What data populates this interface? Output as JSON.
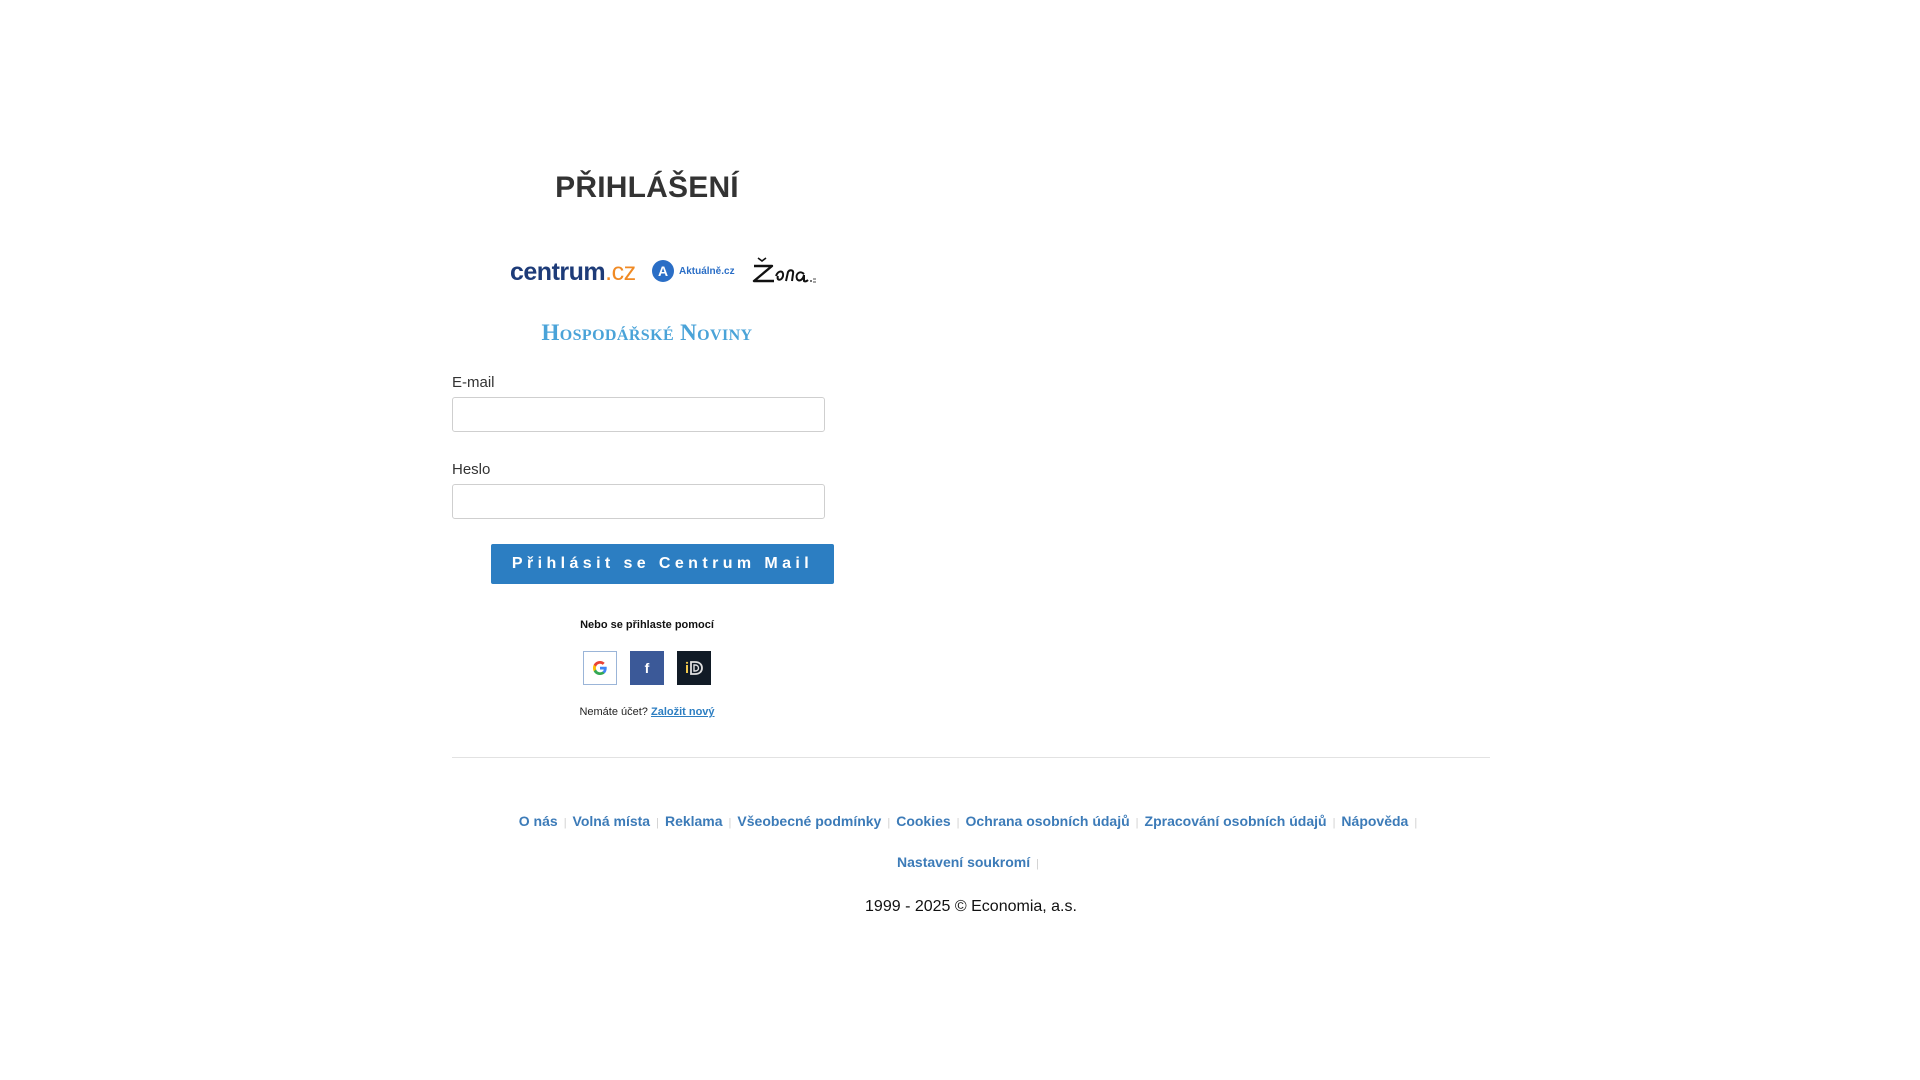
{
  "login": {
    "title": "PŘIHLÁŠENÍ",
    "logos": {
      "centrum_main": "centrum",
      "centrum_tld": ".cz",
      "aktualne_letter": "A",
      "aktualne_text": "Aktuálně.cz",
      "zena": "Žena.cz",
      "hn": "Hospodářské Noviny"
    },
    "email_label": "E-mail",
    "email_value": "",
    "password_label": "Heslo",
    "password_value": "",
    "submit_label": "Přihlásit se Centrum Mail",
    "social_title": "Nebo se přihlaste pomocí",
    "social_buttons": [
      {
        "name": "google",
        "icon": "google-icon",
        "glyph": "G",
        "color": "#4285f4"
      },
      {
        "name": "facebook",
        "icon": "facebook-icon",
        "glyph": "f",
        "color": "#3b5998"
      },
      {
        "name": "bankid",
        "icon": "bankid-icon",
        "glyph": "iD",
        "color": "#111b26"
      }
    ],
    "no_account_text": "Nemáte účet?",
    "register_link": "Založit nový"
  },
  "footer": {
    "links": [
      "O nás",
      "Volná místa",
      "Reklama",
      "Všeobecné podmínky",
      "Cookies",
      "Ochrana osobních údajů",
      "Zpracování osobních údajů",
      "Nápověda",
      "Nastavení soukromí"
    ],
    "copyright": "1999 - 2025 © Economia, a.s."
  },
  "colors": {
    "primary_button": "#2c7ec2",
    "link": "#3c7bb8",
    "hn_logo": "#4aa3d8",
    "centrum_blue": "#1d3b78",
    "centrum_orange": "#f08a24"
  }
}
